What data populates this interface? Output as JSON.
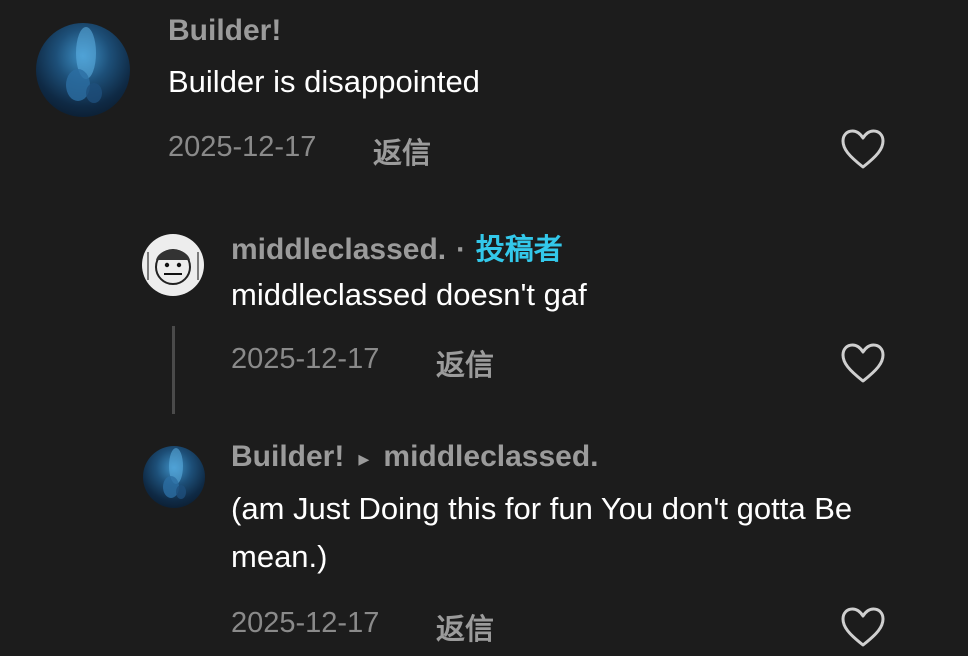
{
  "comments": [
    {
      "username": "Builder!",
      "text": "Builder is disappointed",
      "date": "2025-12-17",
      "reply_label": "返信"
    },
    {
      "username": "middleclassed.",
      "separator": "·",
      "author_badge": "投稿者",
      "text": "middleclassed doesn't gaf",
      "date": "2025-12-17",
      "reply_label": "返信"
    },
    {
      "username": "Builder!",
      "reply_to_arrow": "▸",
      "reply_to": "middleclassed.",
      "text": "(am Just Doing this for fun You don't gotta Be mean.)",
      "date": "2025-12-17",
      "reply_label": "返信"
    }
  ],
  "icons": {
    "like": "heart-outline-icon"
  },
  "colors": {
    "background": "#1c1c1c",
    "author_badge": "#33c8ea",
    "username": "#9b9b9b",
    "date": "#8a8a8a"
  }
}
